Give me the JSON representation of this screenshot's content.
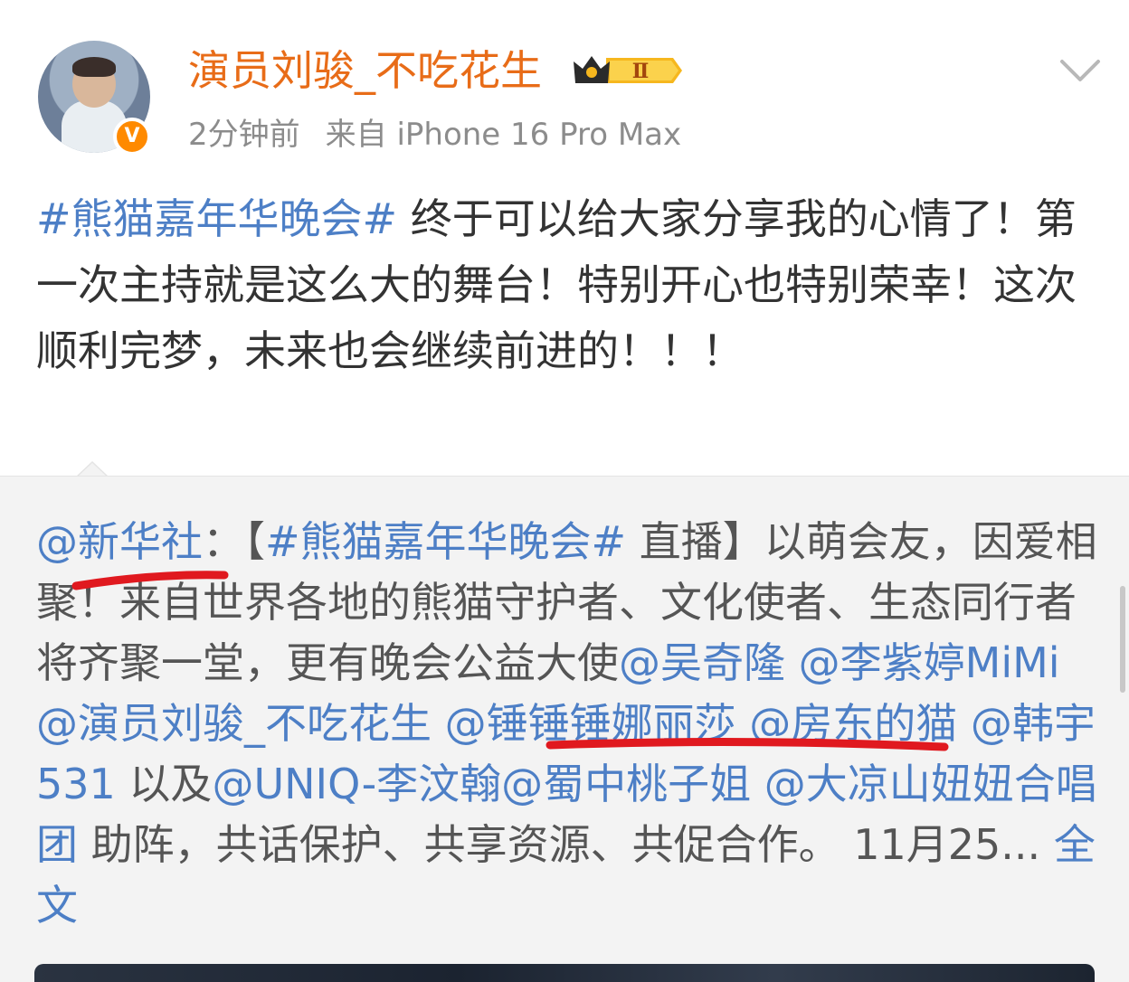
{
  "author": {
    "name": "演员刘骏_不吃花生",
    "verified_badge": "V",
    "vip_level": "Ⅱ",
    "time": "2分钟前",
    "source": "来自 iPhone 16 Pro Max"
  },
  "post": {
    "hashtag": "#熊猫嘉年华晚会#",
    "text": " 终于可以给大家分享我的心情了！第一次主持就是这么大的舞台！特别开心也特别荣幸！这次顺利完梦，未来也会继续前进的！！！"
  },
  "repost": {
    "mention_origin": "@新华社",
    "sep": "：【",
    "hashtag": "#熊猫嘉年华晚会#",
    "t1": " 直播】以萌会友，因爱相聚！来自世界各地的熊猫守护者、文化使者、生态同行者将齐聚一堂，更有晚会公益大使",
    "m1": "@吴奇隆",
    "m2": "@李紫婷MiMi",
    "m3": "@演员刘骏_不吃花生",
    "m4": "@锤锤锤娜丽莎",
    "m5": "@房东的猫",
    "m6": "@韩宇531",
    "t2": " 以及",
    "m7": "@UNIQ-李汶翰",
    "m8": "@蜀中桃子姐",
    "m9": "@大凉山妞妞合唱团",
    "t3": " 助阵，共话保护、共享资源、共促合作。 11月25...",
    "full_text": "全文"
  },
  "colors": {
    "link": "#4d7fc6",
    "name": "#e86c18",
    "annotation": "#e0191f"
  }
}
